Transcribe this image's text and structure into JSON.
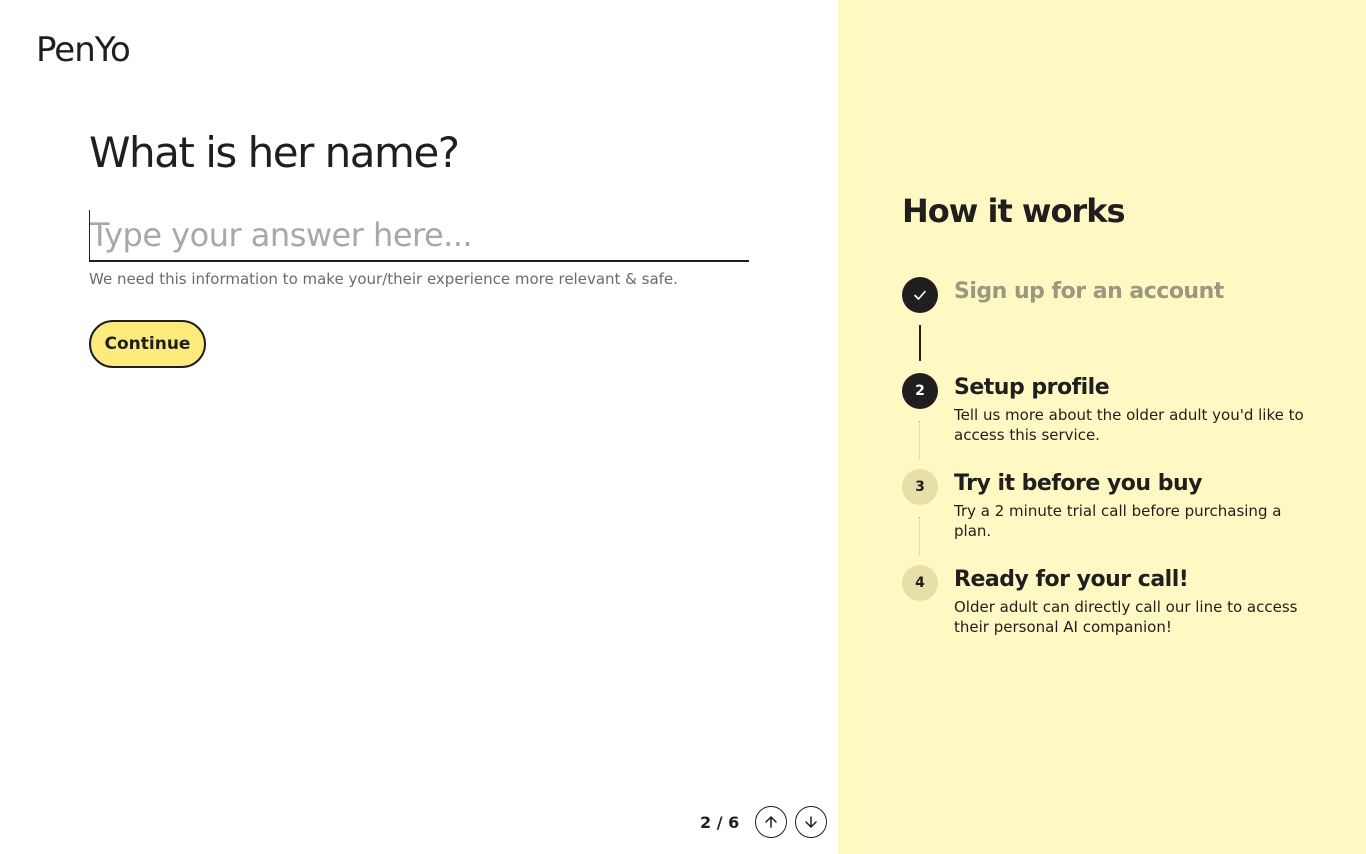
{
  "brand": {
    "logo_text": "PenYo"
  },
  "form": {
    "question": "What is her name?",
    "answer_value": "",
    "answer_placeholder": "Type your answer here...",
    "helper_text": "We need this information to make your/their experience more relevant & safe.",
    "continue_label": "Continue"
  },
  "pager": {
    "current": 2,
    "total": 6,
    "text": "2 / 6",
    "up_icon": "arrow-up-icon",
    "down_icon": "arrow-down-icon"
  },
  "how_it_works": {
    "title": "How it works",
    "steps": [
      {
        "number": "",
        "icon": "checkmark-icon",
        "title": "Sign up for an account",
        "description": "",
        "status": "done"
      },
      {
        "number": "2",
        "title": "Setup profile",
        "description": "Tell us more about the older adult you'd like to access this service.",
        "status": "current"
      },
      {
        "number": "3",
        "title": "Try it before you buy",
        "description": "Try a 2 minute trial call before purchasing a plan.",
        "status": "upcoming"
      },
      {
        "number": "4",
        "title": "Ready for your call!",
        "description": "Older adult can directly call our line to access their personal AI companion!",
        "status": "upcoming"
      }
    ]
  },
  "colors": {
    "accent_yellow": "#fcea7a",
    "panel_yellow": "#fef8c2",
    "text_dark": "#1f1f1f",
    "muted_text": "#9a9880"
  }
}
